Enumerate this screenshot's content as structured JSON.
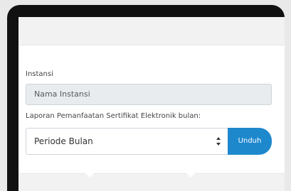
{
  "form": {
    "instansi_label": "Instansi",
    "instansi_value": "Nama Instansi",
    "laporan_label": "Laporan Pemanfaatan Sertifikat Elektronik bulan:",
    "periode_selected": "Periode Bulan",
    "unduh_label": "Unduh"
  },
  "colors": {
    "accent": "#1e88cd",
    "readonly_bg": "#e9ecef",
    "frame": "#111111"
  },
  "icons": {
    "select_arrows": "sort-arrows-icon"
  }
}
